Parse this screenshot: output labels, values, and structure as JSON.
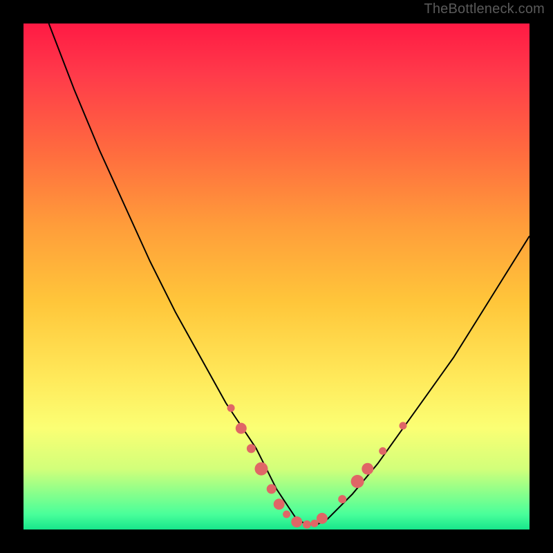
{
  "watermark": "TheBottleneck.com",
  "chart_data": {
    "type": "line",
    "title": "",
    "xlabel": "",
    "ylabel": "",
    "xlim": [
      0,
      100
    ],
    "ylim": [
      0,
      100
    ],
    "series": [
      {
        "name": "curve",
        "x": [
          5,
          10,
          15,
          20,
          25,
          30,
          35,
          40,
          42,
          44,
          46,
          48,
          50,
          52,
          54,
          56,
          58,
          60,
          65,
          70,
          75,
          80,
          85,
          90,
          95,
          100
        ],
        "y": [
          100,
          87,
          75,
          64,
          53,
          43,
          34,
          25,
          22,
          19,
          16,
          12,
          8,
          5,
          2,
          1,
          1,
          2,
          7,
          13,
          20,
          27,
          34,
          42,
          50,
          58
        ]
      }
    ],
    "markers": [
      {
        "x": 41,
        "y": 24,
        "r": 1.1
      },
      {
        "x": 43,
        "y": 20,
        "r": 1.6
      },
      {
        "x": 45,
        "y": 16,
        "r": 1.3
      },
      {
        "x": 47,
        "y": 12,
        "r": 1.9
      },
      {
        "x": 49,
        "y": 8,
        "r": 1.4
      },
      {
        "x": 50.5,
        "y": 5,
        "r": 1.6
      },
      {
        "x": 52,
        "y": 3,
        "r": 1.1
      },
      {
        "x": 54,
        "y": 1.5,
        "r": 1.6
      },
      {
        "x": 56,
        "y": 1,
        "r": 1.2
      },
      {
        "x": 57.5,
        "y": 1.2,
        "r": 1.1
      },
      {
        "x": 59,
        "y": 2.2,
        "r": 1.6
      },
      {
        "x": 63,
        "y": 6,
        "r": 1.2
      },
      {
        "x": 66,
        "y": 9.5,
        "r": 1.9
      },
      {
        "x": 68,
        "y": 12,
        "r": 1.7
      },
      {
        "x": 71,
        "y": 15.5,
        "r": 1.1
      },
      {
        "x": 75,
        "y": 20.5,
        "r": 1.1
      }
    ],
    "marker_color": "#e06666",
    "curve_color": "#000000"
  }
}
